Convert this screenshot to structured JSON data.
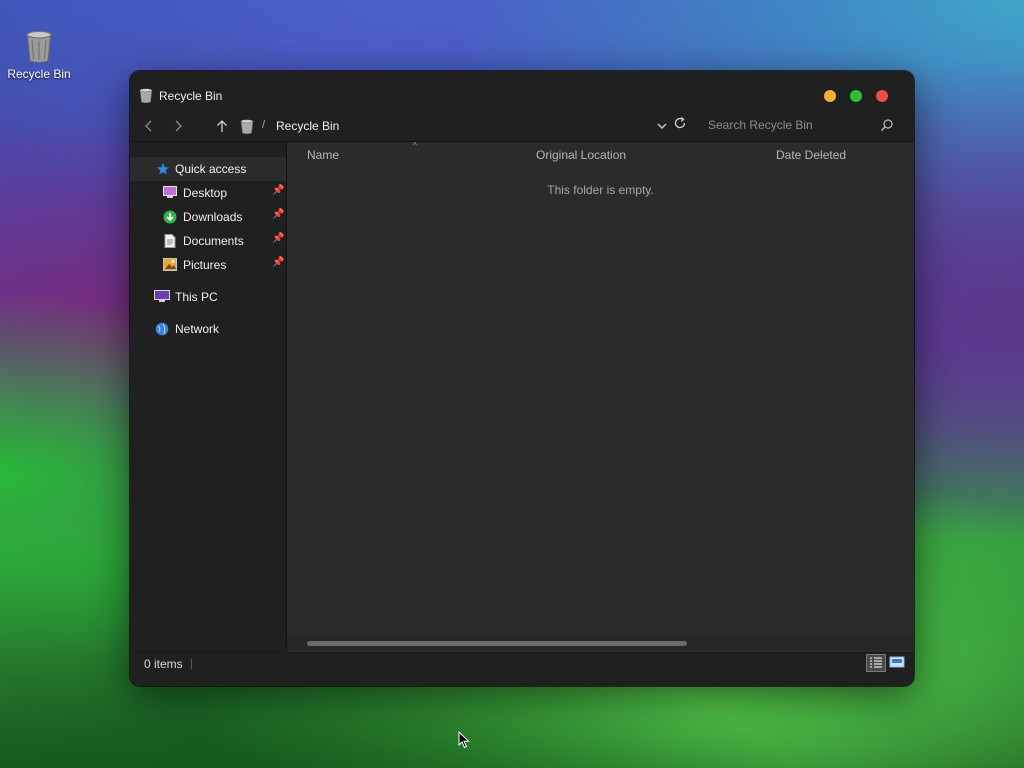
{
  "desktop": {
    "icons": [
      {
        "label": "Recycle Bin",
        "icon": "recycle-bin-icon"
      }
    ]
  },
  "window": {
    "title": "Recycle Bin",
    "controls": {
      "minimize_color": "#f4b12e",
      "maximize_color": "#2dc13b",
      "close_color": "#ee4c4c"
    },
    "breadcrumb": {
      "separator": "/",
      "current": "Recycle Bin"
    },
    "search": {
      "placeholder": "Search Recycle Bin",
      "value": ""
    },
    "sidebar": {
      "items": [
        {
          "label": "Quick access",
          "icon": "star-icon",
          "active": true
        },
        {
          "label": "Desktop",
          "icon": "desktop-folder-icon",
          "pinned": true
        },
        {
          "label": "Downloads",
          "icon": "download-icon",
          "pinned": true
        },
        {
          "label": "Documents",
          "icon": "document-icon",
          "pinned": true
        },
        {
          "label": "Pictures",
          "icon": "pictures-icon",
          "pinned": true
        },
        {
          "label": "This PC",
          "icon": "computer-icon"
        },
        {
          "label": "Network",
          "icon": "network-icon"
        }
      ]
    },
    "columns": [
      "Name",
      "Original Location",
      "Date Deleted"
    ],
    "empty_message": "This folder is empty.",
    "status": {
      "item_count": "0 items"
    },
    "colors": {
      "window_bg": "#202020",
      "content_bg": "#2b2b2b",
      "accent_blue": "#2f7be0"
    }
  }
}
